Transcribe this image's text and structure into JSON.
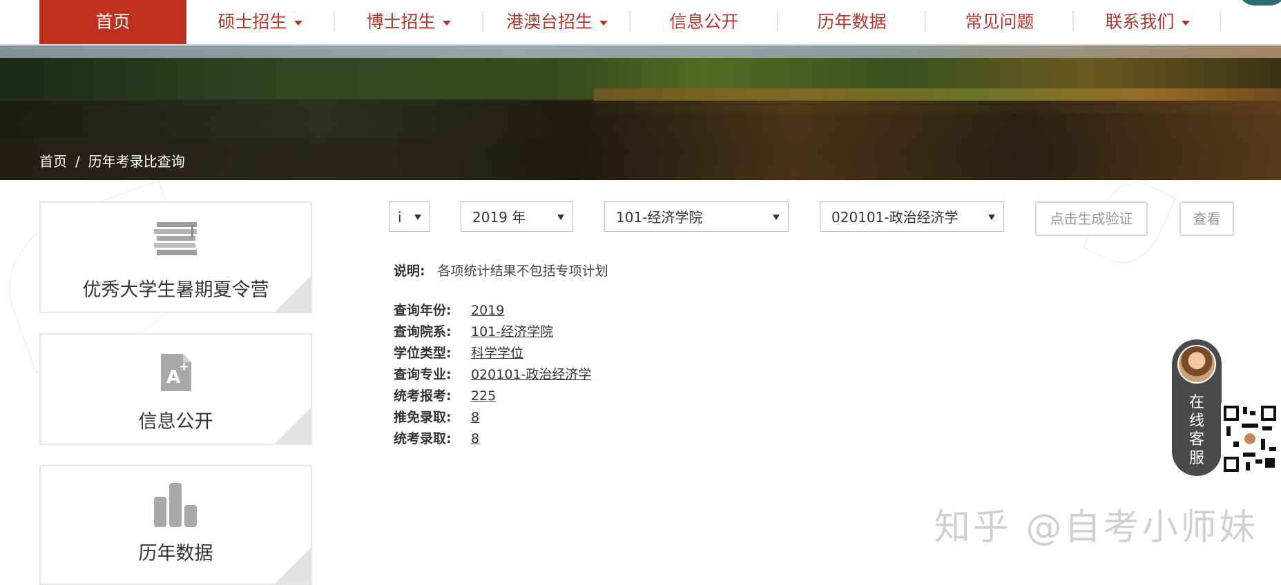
{
  "nav": {
    "items": [
      {
        "label": "首页"
      },
      {
        "label": "硕士招生"
      },
      {
        "label": "博士招生"
      },
      {
        "label": "港澳台招生"
      },
      {
        "label": "信息公开"
      },
      {
        "label": "历年数据"
      },
      {
        "label": "常见问题"
      },
      {
        "label": "联系我们"
      }
    ]
  },
  "breadcrumb": {
    "home": "首页",
    "separator": "/",
    "current": "历年考录比查询"
  },
  "sidebar": {
    "cards": [
      {
        "label": "优秀大学生暑期夏令营",
        "icon": "books-icon"
      },
      {
        "label": "信息公开",
        "icon": "document-aplus-icon"
      },
      {
        "label": "历年数据",
        "icon": "bar-chart-icon"
      }
    ]
  },
  "filters": {
    "type_value": "i",
    "year_value": "2019 年",
    "dept_value": "101-经济学院",
    "major_value": "020101-政治经济学",
    "captcha_placeholder": "点击生成验证",
    "query_label": "查看"
  },
  "note": {
    "label": "说明:",
    "text": "各项统计结果不包括专项计划"
  },
  "results": [
    {
      "key": "查询年份:",
      "value": "2019"
    },
    {
      "key": "查询院系:",
      "value": "101-经济学院"
    },
    {
      "key": "学位类型:",
      "value": "科学学位"
    },
    {
      "key": "查询专业:",
      "value": "020101-政治经济学"
    },
    {
      "key": "统考报考:",
      "value": "225"
    },
    {
      "key": "推免录取:",
      "value": "8"
    },
    {
      "key": "统考录取:",
      "value": "8"
    }
  ],
  "service": {
    "label": "在线客服"
  },
  "watermark": "知乎 @自考小师妹",
  "colors": {
    "brand": "#c0301f",
    "nav_text": "#b5342a",
    "service_bg": "#4a4a4a"
  }
}
